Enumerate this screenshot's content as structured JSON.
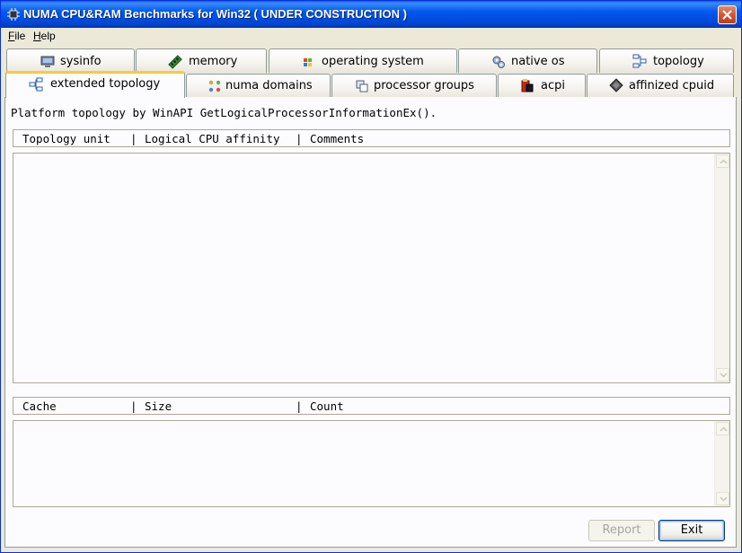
{
  "window": {
    "title": "NUMA CPU&RAM Benchmarks for Win32 ( UNDER CONSTRUCTION )",
    "app_icon": "chip-icon",
    "close_icon": "close-icon"
  },
  "menu": {
    "file": {
      "accel": "F",
      "rest": "ile"
    },
    "help": {
      "accel": "H",
      "rest": "elp"
    }
  },
  "tabs_row1": [
    {
      "label": "sysinfo",
      "icon": "monitor-icon"
    },
    {
      "label": "memory",
      "icon": "memory-stick-icon"
    },
    {
      "label": "operating system",
      "icon": "windows-flag-icon"
    },
    {
      "label": "native os",
      "icon": "gears-icon"
    },
    {
      "label": "topology",
      "icon": "topology-icon"
    }
  ],
  "tabs_row2": [
    {
      "label": "extended topology",
      "icon": "extended-topology-icon",
      "active": true
    },
    {
      "label": "numa domains",
      "icon": "numa-dots-icon"
    },
    {
      "label": "processor groups",
      "icon": "processor-groups-icon"
    },
    {
      "label": "acpi",
      "icon": "acpi-icon"
    },
    {
      "label": "affinized cpuid",
      "icon": "cpuid-chip-icon"
    }
  ],
  "panel": {
    "description": "Platform topology by WinAPI GetLogicalProcessorInformationEx().",
    "topology_header": {
      "col1": "Topology unit",
      "sep1": "|",
      "col2": "Logical CPU affinity",
      "sep2": "|",
      "col3": "Comments"
    },
    "cache_header": {
      "col1": "Cache",
      "sep1": "|",
      "col2": "Size",
      "sep2": "|",
      "col3": "Count"
    },
    "topology_rows": [],
    "cache_rows": []
  },
  "buttons": {
    "report": "Report",
    "exit": "Exit"
  },
  "colors": {
    "titlebar": "#0058ee",
    "active_tab_highlight": "#ffc83c",
    "face": "#ece9d8"
  }
}
